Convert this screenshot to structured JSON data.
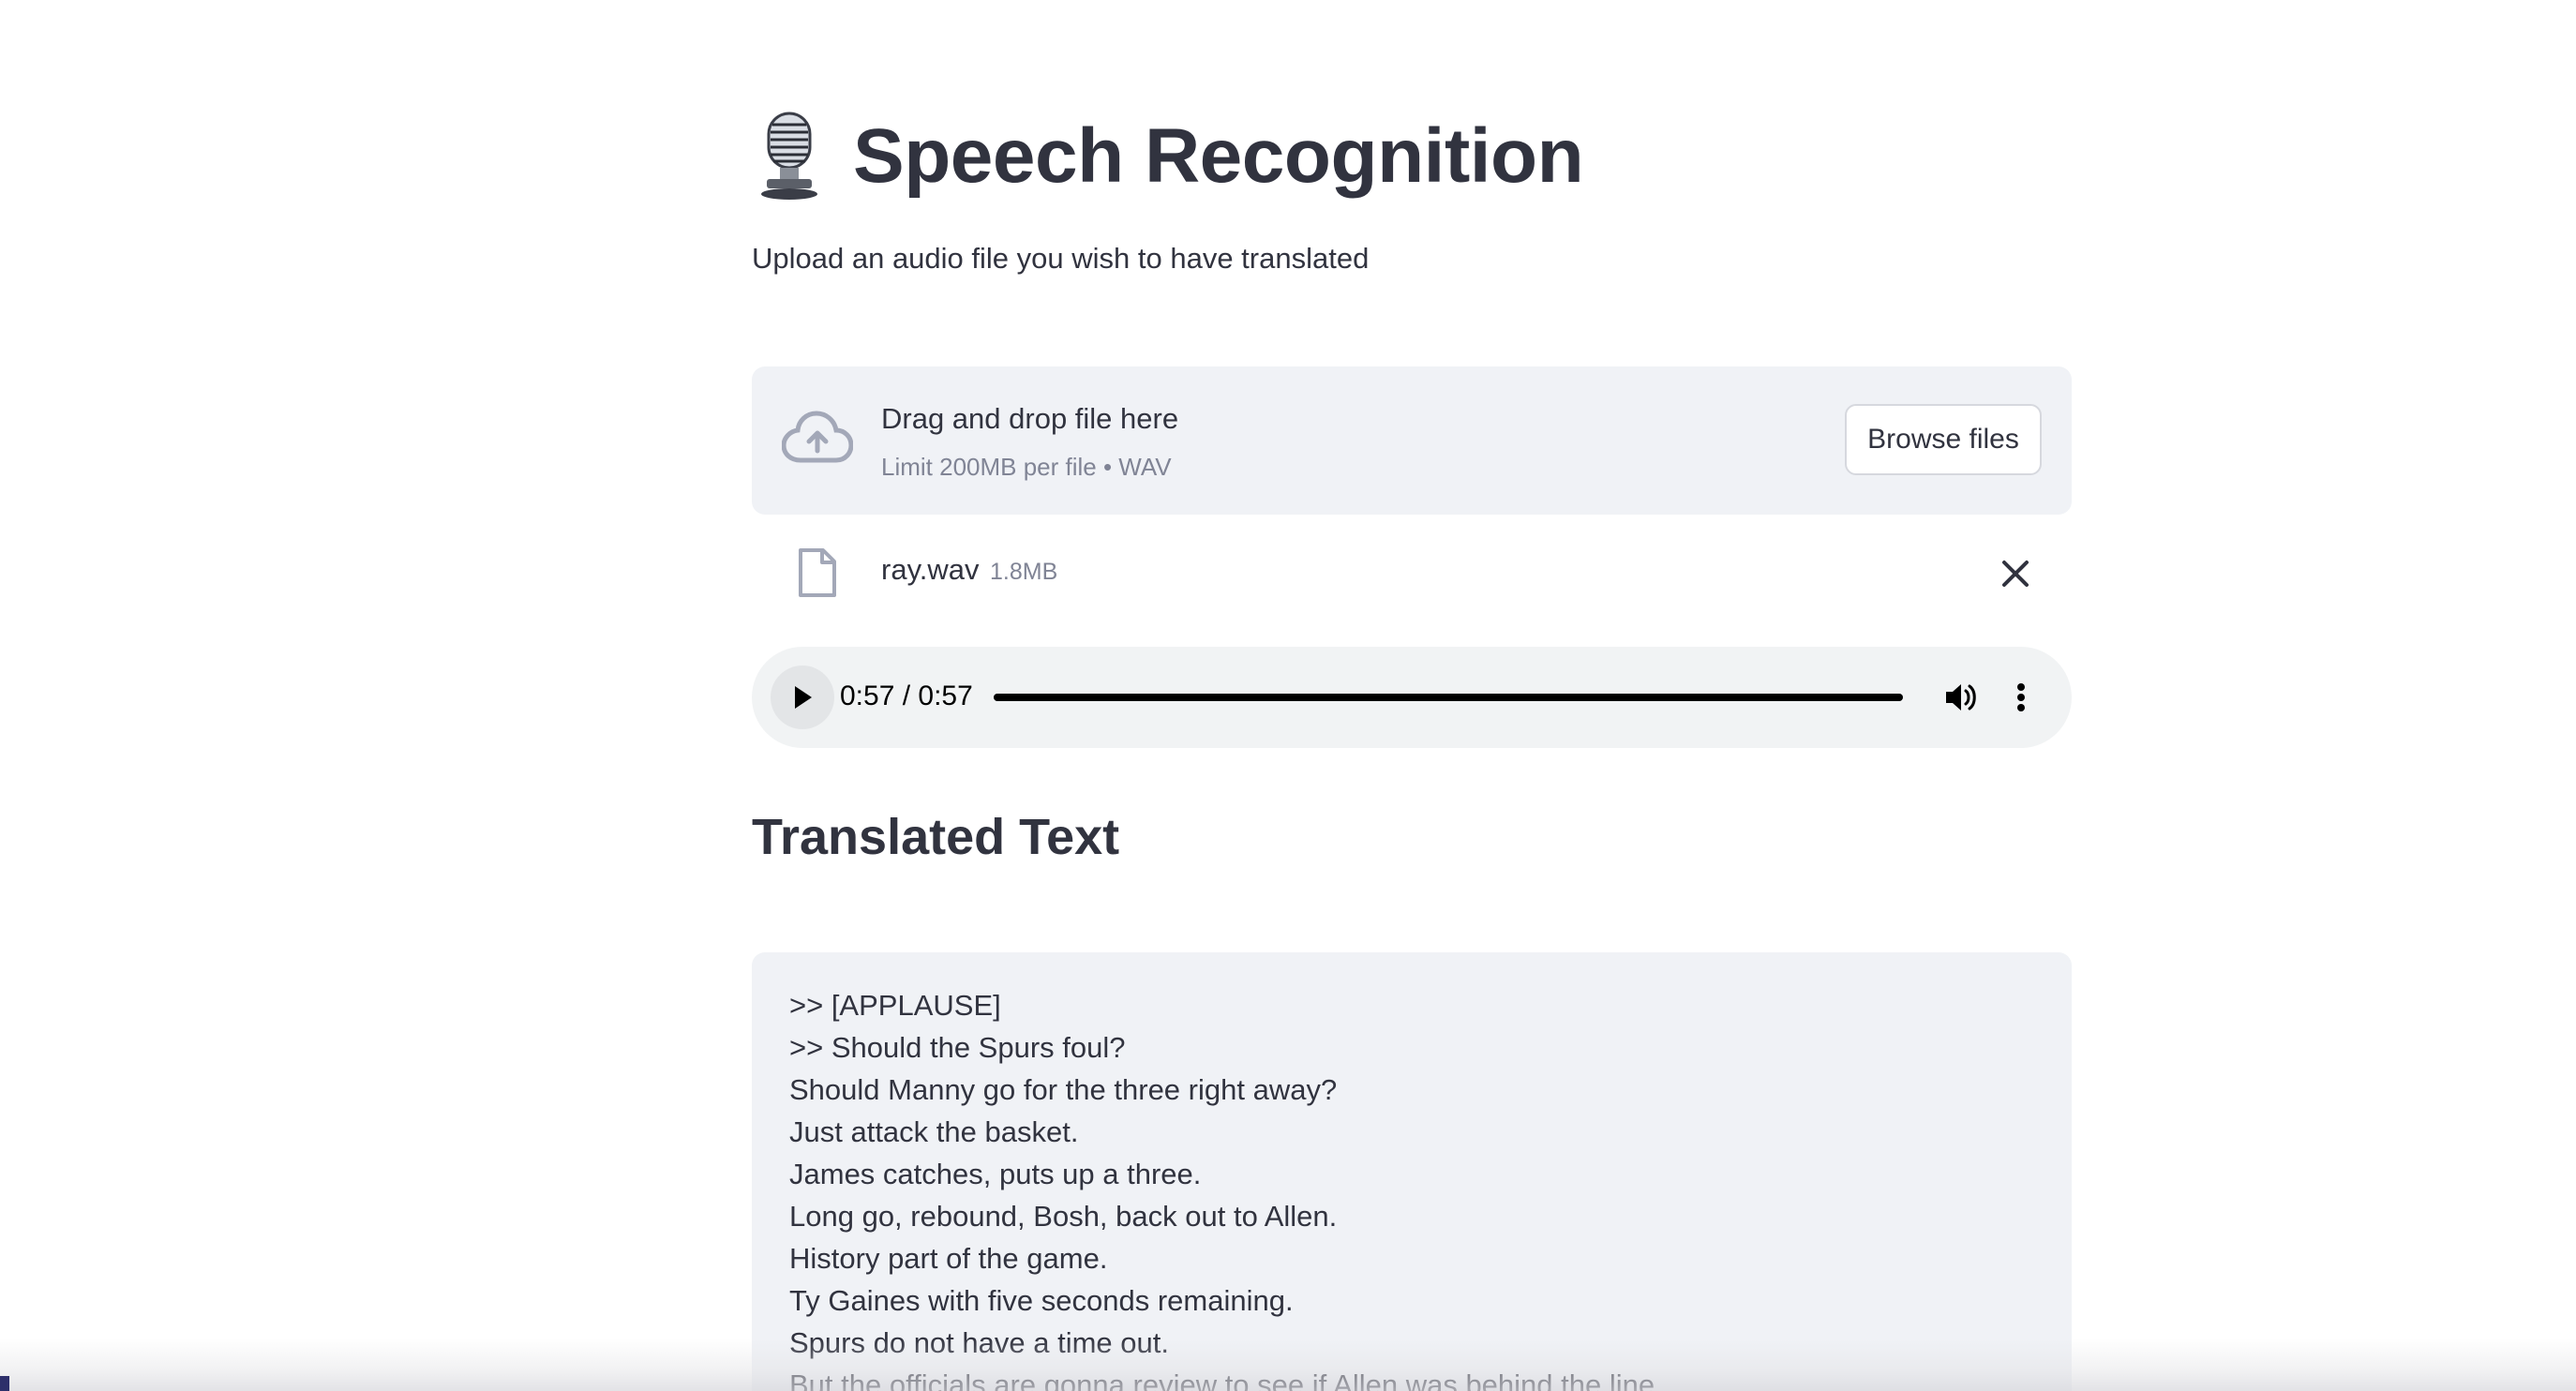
{
  "header": {
    "title": "Speech Recognition",
    "subtitle": "Upload an audio file you wish to have translated",
    "icon": "microphone-icon"
  },
  "uploader": {
    "drop_title": "Drag and drop file here",
    "limit_text": "Limit 200MB per file • WAV",
    "browse_label": "Browse files",
    "icon": "cloud-upload-icon"
  },
  "file": {
    "name": "ray.wav",
    "size": "1.8MB",
    "icon": "file-icon",
    "remove_icon": "close-icon"
  },
  "audio_player": {
    "time": "0:57 / 0:57",
    "progress": 1.0,
    "icons": [
      "play-icon",
      "volume-icon",
      "more-vertical-icon"
    ]
  },
  "translated": {
    "heading": "Translated Text",
    "lines": [
      ">> [APPLAUSE]",
      ">> Should the Spurs foul?",
      "Should Manny go for the three right away?",
      "Just attack the basket.",
      "James catches, puts up a three.",
      "Long go, rebound, Bosh, back out to Allen.",
      "History part of the game.",
      "Ty Gaines with five seconds remaining.",
      "Spurs do not have a time out.",
      "But the officials are gonna review to see if Allen was behind the line."
    ]
  },
  "colors": {
    "text": "#31333f",
    "muted": "#808495",
    "panel": "#f0f2f6",
    "player": "#f1f3f4"
  }
}
